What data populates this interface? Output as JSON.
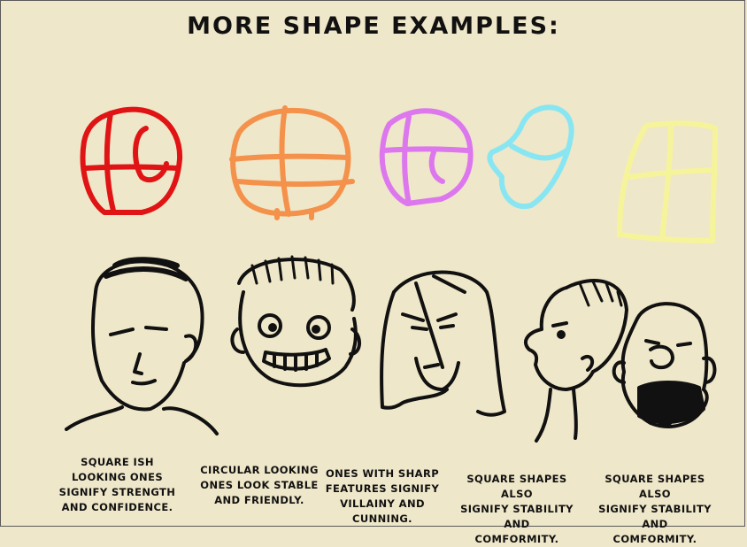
{
  "title": "More shape examples:",
  "shapes": [
    {
      "name": "square-ish head shape",
      "color": "#e01414"
    },
    {
      "name": "circular head shape",
      "color": "#f4914a"
    },
    {
      "name": "sharp head shape",
      "color": "#dd77ee"
    },
    {
      "name": "rounded bean head shape",
      "color": "#88e6f2"
    },
    {
      "name": "square head shape",
      "color": "#f6f49a"
    }
  ],
  "captions": [
    {
      "lines": [
        "square ish",
        "looking ones",
        "signify strength",
        "and confidence."
      ]
    },
    {
      "lines": [
        "circular looking",
        "ones look stable",
        "and friendly."
      ]
    },
    {
      "lines": [
        "ones with sharp",
        "features signify",
        "villainy and cunning."
      ]
    },
    {
      "lines": [
        "square shapes also",
        "signify stability and",
        "comformity."
      ]
    },
    {
      "lines": [
        "square shapes also",
        "signify stability and",
        "comformity."
      ]
    }
  ]
}
